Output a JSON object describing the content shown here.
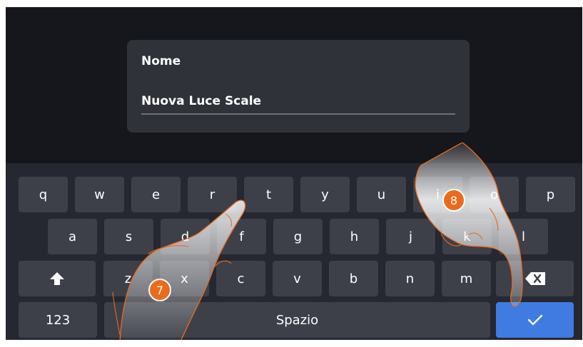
{
  "dialog": {
    "title": "Nome",
    "value": "Nuova Luce Scale"
  },
  "keyboard": {
    "row1": [
      "q",
      "w",
      "e",
      "r",
      "t",
      "y",
      "u",
      "i",
      "o",
      "p"
    ],
    "row2": [
      "a",
      "s",
      "d",
      "f",
      "g",
      "h",
      "j",
      "k",
      "l"
    ],
    "row3": [
      "z",
      "x",
      "c",
      "v",
      "b",
      "n",
      "m"
    ],
    "numbers_label": "123",
    "space_label": "Spazio",
    "shift_icon": "shift-arrow-icon",
    "backspace_icon": "backspace-icon",
    "enter_icon": "check-icon"
  },
  "callouts": [
    "7",
    "8"
  ],
  "colors": {
    "screen_bg": "#15171c",
    "dialog_bg": "#2f3239",
    "keyboard_bg": "#252830",
    "key_bg": "#3d4049",
    "enter_key": "#3f7be0",
    "callout": "#ea6b1b"
  }
}
